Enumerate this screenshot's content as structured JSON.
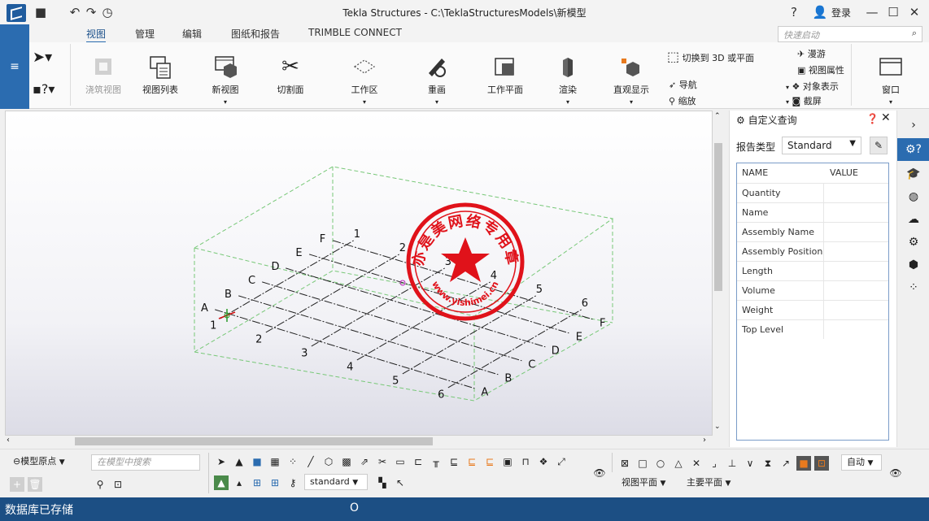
{
  "titlebar": {
    "title": "Tekla Structures - C:\\TeklaStructuresModels\\新模型",
    "login": "登录"
  },
  "tabs": [
    "视图",
    "管理",
    "编辑",
    "图纸和报告",
    "TRIMBLE CONNECT"
  ],
  "quick_launch_placeholder": "快速启动",
  "ribbon": {
    "buttons": [
      "浇筑视图",
      "视图列表",
      "新视图",
      "切割面",
      "工作区",
      "重画",
      "工作平面",
      "渲染",
      "直观显示",
      "窗口"
    ],
    "small": {
      "switch3d": "切换到 3D 或平面",
      "navigate": "导航",
      "zoom": "缩放",
      "fly": "漫游",
      "view_props": "视图属性",
      "object_props": "对象表示",
      "screenshot": "截屏"
    }
  },
  "grid": {
    "numbers": [
      "1",
      "2",
      "3",
      "4",
      "5",
      "6"
    ],
    "letters": [
      "A",
      "B",
      "C",
      "D",
      "E",
      "F"
    ]
  },
  "stamp": {
    "text": "亦是美网络专用章",
    "url": "www.yishimei.cn"
  },
  "panel": {
    "title": "自定义查询",
    "report_type_label": "报告类型",
    "report_type_value": "Standard",
    "columns": [
      "NAME",
      "VALUE"
    ],
    "rows": [
      "Quantity",
      "Name",
      "Assembly Name",
      "Assembly Position",
      "Length",
      "Volume",
      "Weight",
      "Top Level"
    ]
  },
  "bottom": {
    "origin": "模型原点",
    "search_placeholder": "在模型中搜索",
    "filter": "standard",
    "auto": "自动",
    "view_plane": "视图平面",
    "main_plane": "主要平面"
  },
  "status": {
    "text": "数据库已存储",
    "indicator": "O"
  },
  "colors": {
    "accent": "#2b6cb0",
    "status_bar": "#1c4f84",
    "stamp": "#e0121a",
    "grid_box": "#78c878"
  }
}
